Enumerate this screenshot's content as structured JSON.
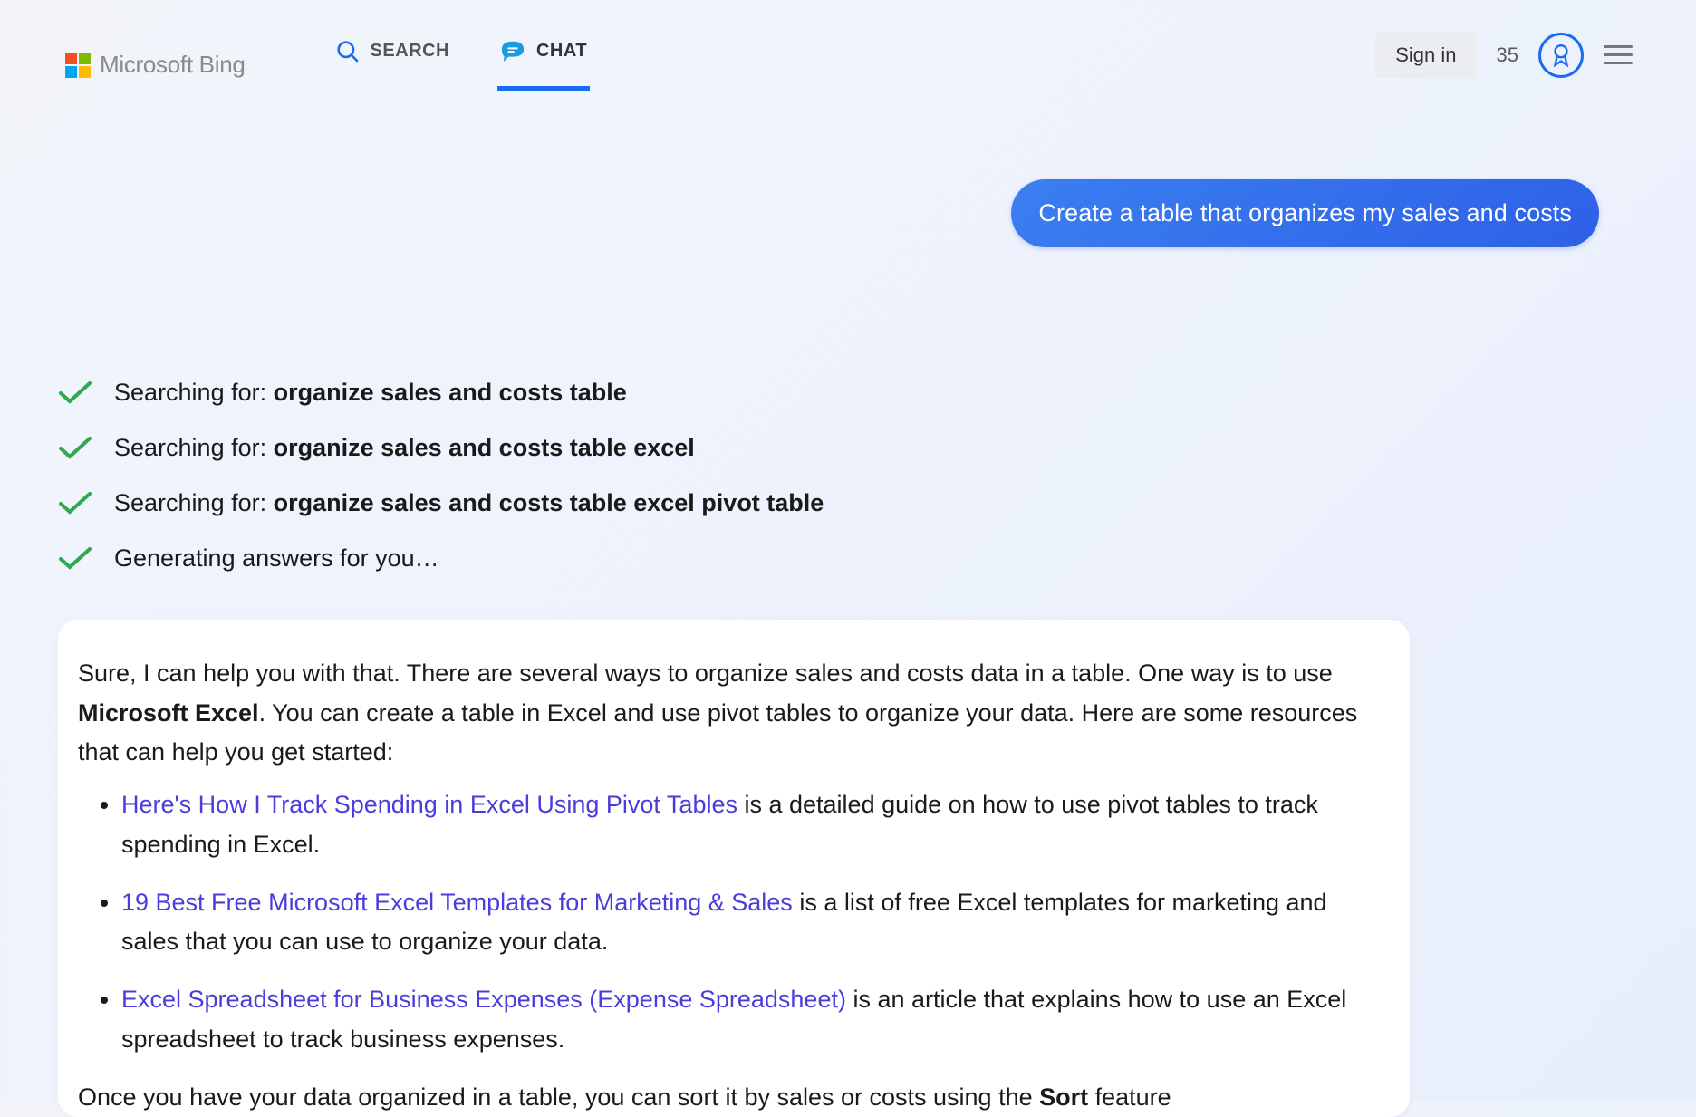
{
  "header": {
    "logo_text": "Microsoft Bing",
    "tab_search_label": "SEARCH",
    "tab_chat_label": "CHAT",
    "signin_label": "Sign in",
    "points": "35"
  },
  "user_message": "Create a table that organizes my sales and costs",
  "status": {
    "searching_prefix": "Searching for: ",
    "q1": "organize sales and costs table",
    "q2": "organize sales and costs table excel",
    "q3": "organize sales and costs table excel pivot table",
    "generating": "Generating answers for you…"
  },
  "answer": {
    "intro_a": "Sure, I can help you with that. There are several ways to organize sales and costs data in a table. One way is to use ",
    "intro_bold": "Microsoft Excel",
    "intro_b": ". You can create a table in Excel and use pivot tables to organize your data. Here are some resources that can help you get started:",
    "li1_link": "Here's How I Track Spending in Excel Using Pivot Tables",
    "li1_rest": " is a detailed guide on how to use pivot tables to track spending in Excel.",
    "li2_link": "19 Best Free Microsoft Excel Templates for Marketing & Sales",
    "li2_rest": " is a list of free Excel templates for marketing and sales that you can use to organize your data.",
    "li3_link": "Excel Spreadsheet for Business Expenses (Expense Spreadsheet)",
    "li3_rest": " is an article that explains how to use an Excel spreadsheet to track business expenses.",
    "outro_a": "Once you have your data organized in a table, you can sort it by sales or costs using the ",
    "outro_bold": "Sort",
    "outro_b": " feature"
  }
}
